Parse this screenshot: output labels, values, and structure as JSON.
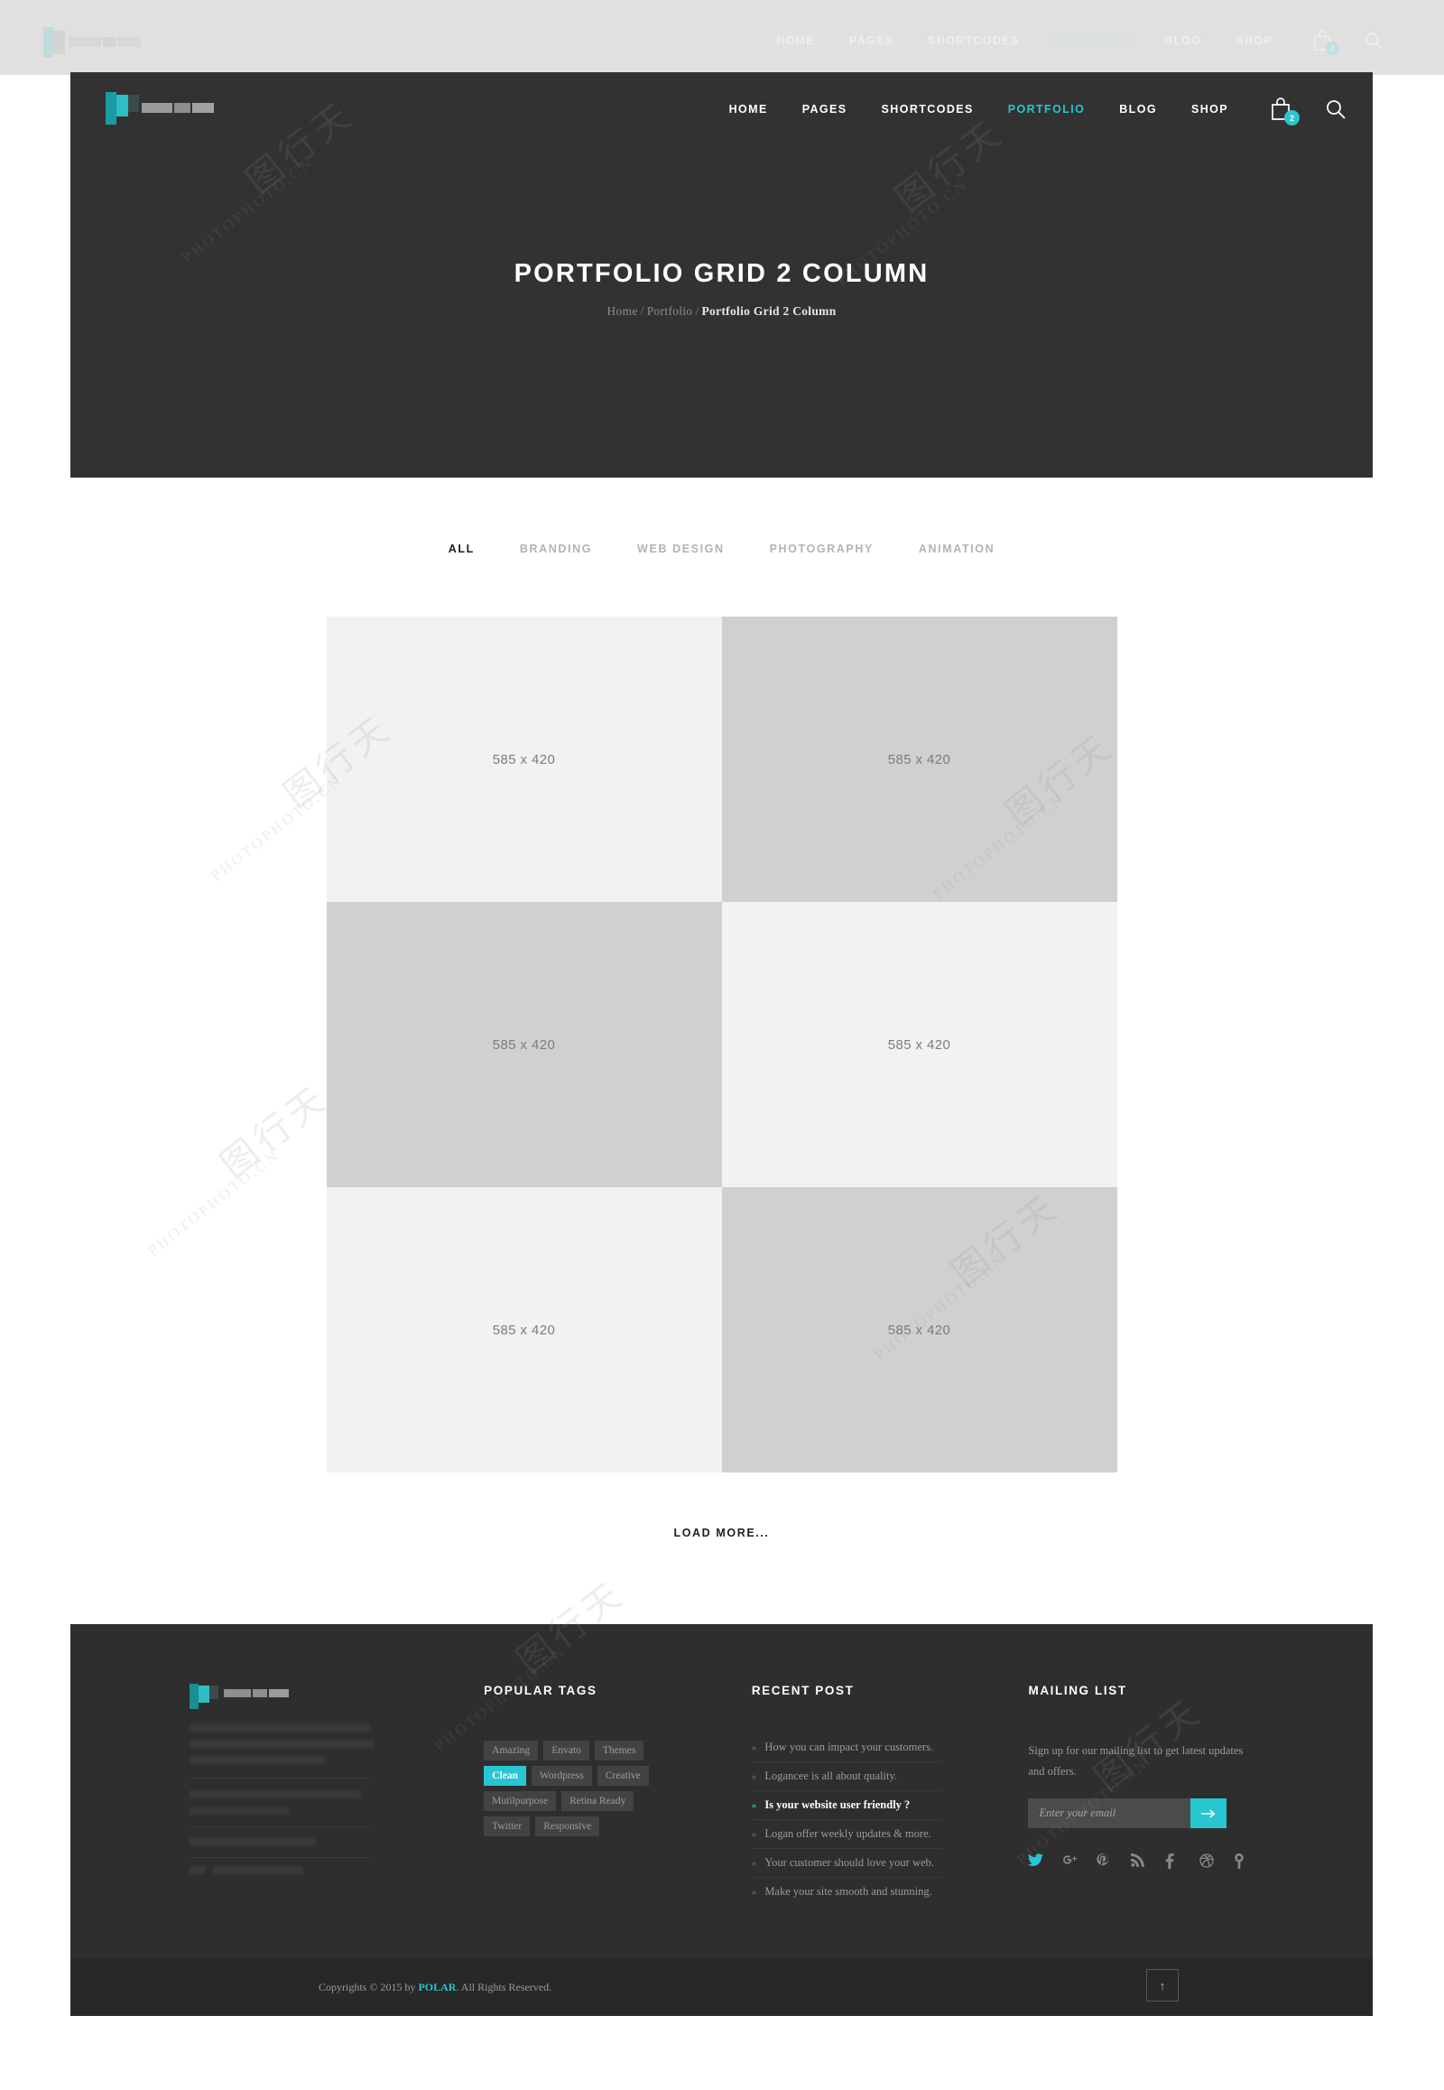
{
  "accent_color": "#28c6d0",
  "header": {
    "logo_name": "polar-logo",
    "nav": [
      {
        "label": "HOME",
        "active": false
      },
      {
        "label": "PAGES",
        "active": false
      },
      {
        "label": "SHORTCODES",
        "active": false
      },
      {
        "label": "PORTFOLIO",
        "active": true
      },
      {
        "label": "BLOG",
        "active": false
      },
      {
        "label": "SHOP",
        "active": false
      }
    ],
    "cart_icon": "shopping-bag-icon",
    "cart_count": "2",
    "search_icon": "search-icon"
  },
  "hero": {
    "title": "PORTFOLIO GRID 2 COLUMN",
    "breadcrumb": {
      "home": "Home",
      "section": "Portfolio",
      "current": "Portfolio Grid 2 Column",
      "separator": "/"
    }
  },
  "portfolio": {
    "filters": [
      {
        "label": "ALL",
        "active": true
      },
      {
        "label": "BRANDING",
        "active": false
      },
      {
        "label": "WEB DESIGN",
        "active": false
      },
      {
        "label": "PHOTOGRAPHY",
        "active": false
      },
      {
        "label": "ANIMATION",
        "active": false
      }
    ],
    "items": [
      {
        "size": "585 x 420",
        "shade": "lite"
      },
      {
        "size": "585 x 420",
        "shade": "dark"
      },
      {
        "size": "585 x 420",
        "shade": "dark"
      },
      {
        "size": "585 x 420",
        "shade": "lite"
      },
      {
        "size": "585 x 420",
        "shade": "lite"
      },
      {
        "size": "585 x 420",
        "shade": "dark"
      }
    ],
    "load_more": "LOAD MORE..."
  },
  "footer": {
    "about": {
      "logo_name": "polar-logo-footer"
    },
    "tags": {
      "title": "POPULAR TAGS",
      "items": [
        {
          "label": "Amazing",
          "active": false
        },
        {
          "label": "Envato",
          "active": false
        },
        {
          "label": "Themes",
          "active": false
        },
        {
          "label": "Clean",
          "active": true
        },
        {
          "label": "Wordpress",
          "active": false
        },
        {
          "label": "Creative",
          "active": false
        },
        {
          "label": "Mutilpurpose",
          "active": false
        },
        {
          "label": "Retina Ready",
          "active": false
        },
        {
          "label": "Twitter",
          "active": false
        },
        {
          "label": "Responsive",
          "active": false
        }
      ]
    },
    "recent": {
      "title": "RECENT POST",
      "bullet": "»",
      "items": [
        {
          "label": "How you can impact your customers.",
          "active": false
        },
        {
          "label": "Logancee is all about quality.",
          "active": false
        },
        {
          "label": "Is your website user friendly ?",
          "active": true
        },
        {
          "label": "Logan offer weekly updates & more.",
          "active": false
        },
        {
          "label": "Your customer should love your web.",
          "active": false
        },
        {
          "label": "Make your site smooth and stunning.",
          "active": false
        }
      ]
    },
    "mailing": {
      "title": "MAILING LIST",
      "description": "Sign up for our mailing list to get latest updates and offers.",
      "placeholder": "Enter your email",
      "value": "",
      "submit_icon": "arrow-right-icon",
      "socials": [
        {
          "name": "twitter-icon",
          "glyph": "t",
          "active": true
        },
        {
          "name": "google-plus-icon",
          "glyph": "g",
          "active": false
        },
        {
          "name": "pinterest-icon",
          "glyph": "p",
          "active": false
        },
        {
          "name": "rss-icon",
          "glyph": "r",
          "active": false
        },
        {
          "name": "facebook-icon",
          "glyph": "f",
          "active": false
        },
        {
          "name": "dribbble-icon",
          "glyph": "d",
          "active": false
        },
        {
          "name": "flickr-icon",
          "glyph": "fl",
          "active": false
        }
      ]
    },
    "copyright": {
      "prefix": "Copyrights © 2015 by ",
      "brand": "POLAR",
      "suffix": ". All Rights Reserved."
    },
    "back_to_top": "↑"
  },
  "watermark": {
    "cn": "图行天",
    "latin": "PHOTOPHOTO.CN"
  }
}
